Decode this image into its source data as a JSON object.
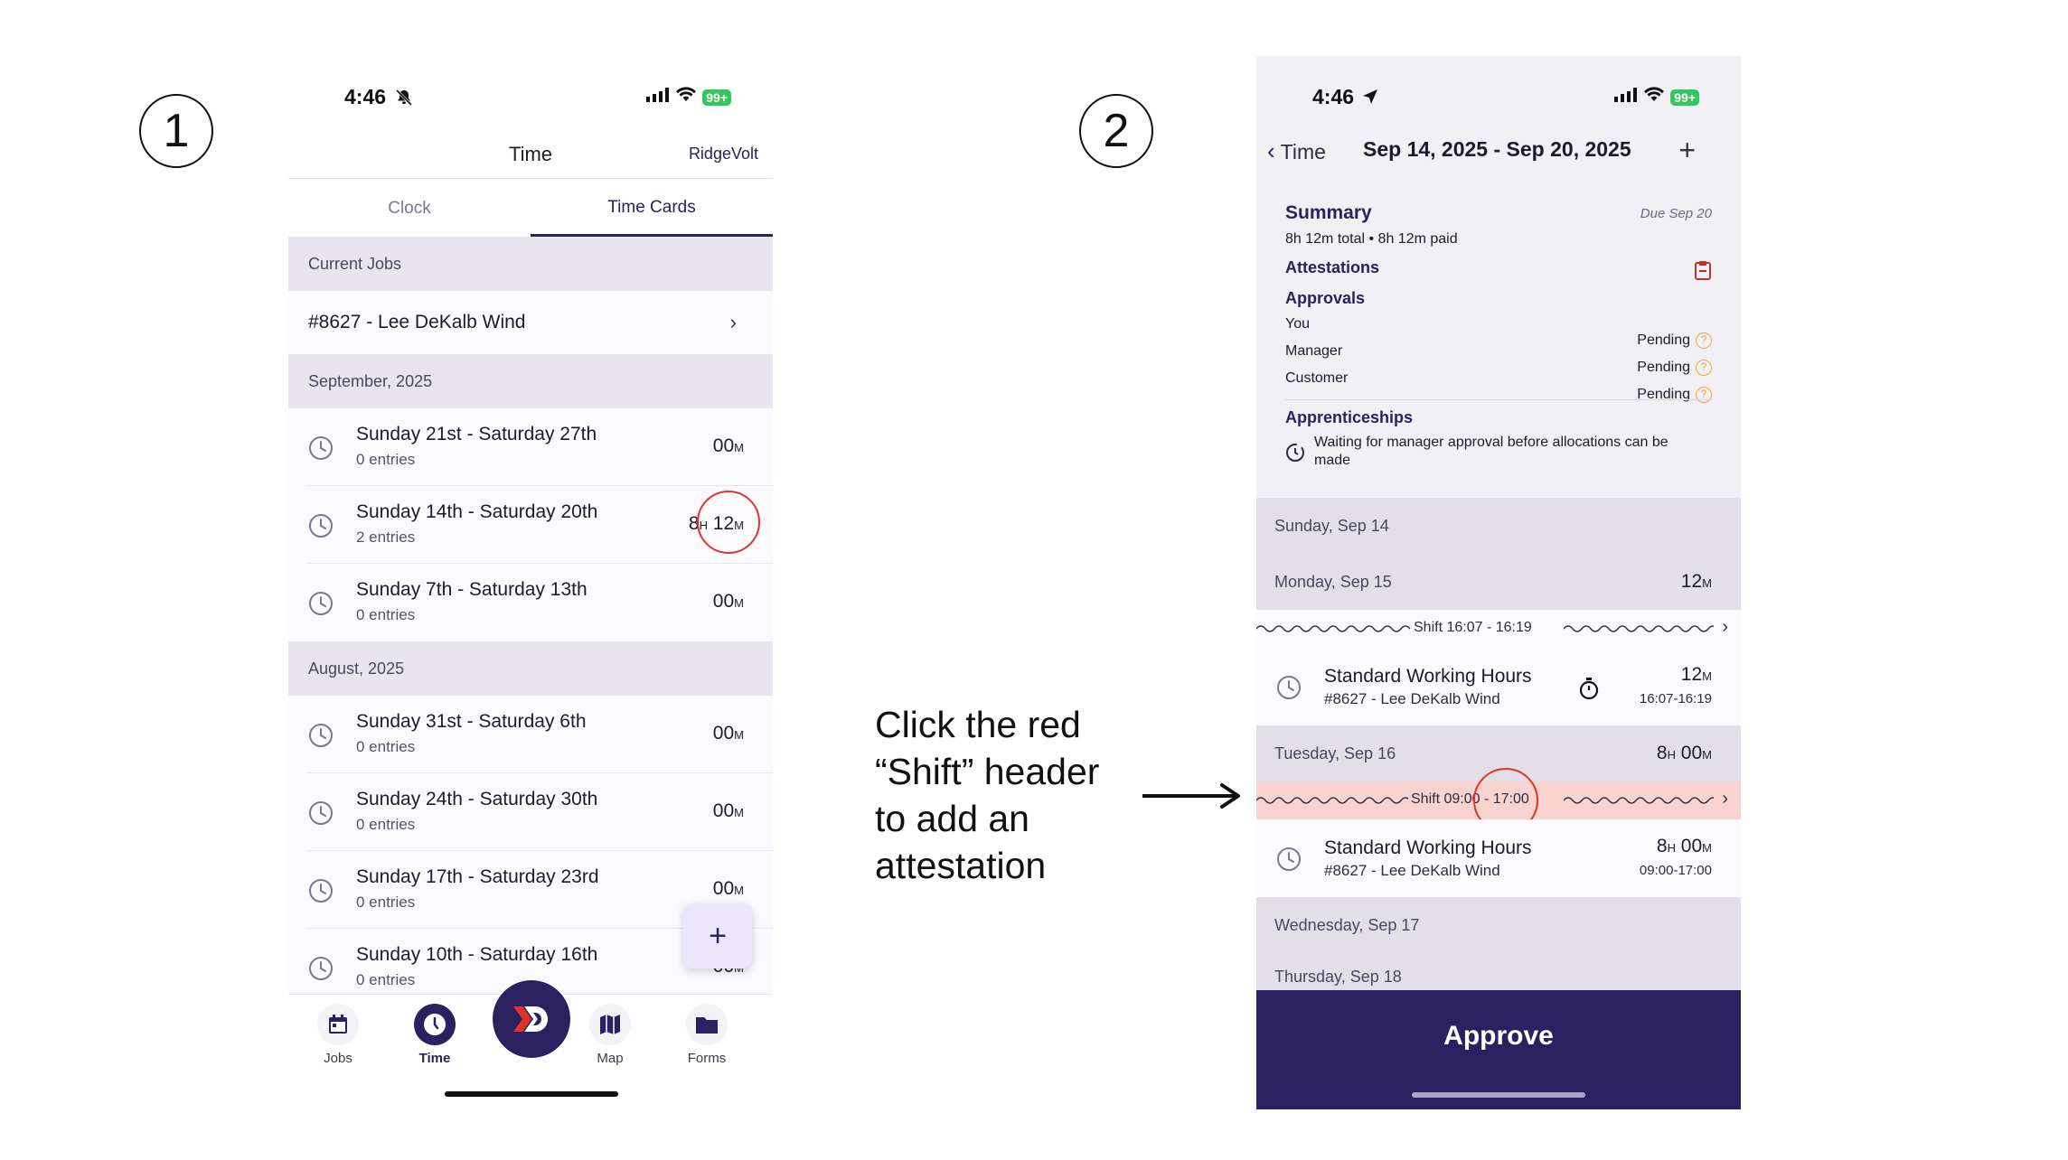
{
  "steps": {
    "one": "1",
    "two": "2"
  },
  "instruction": "Click the red “Shift” header to add an attestation",
  "phone1": {
    "status_time": "4:46",
    "battery": "99+",
    "title": "Time",
    "org": "RidgeVolt",
    "tabs": [
      {
        "label": "Clock"
      },
      {
        "label": "Time Cards"
      }
    ],
    "current_jobs_header": "Current Jobs",
    "current_job": "#8627 - Lee DeKalb Wind",
    "months": [
      {
        "label": "September, 2025",
        "weeks": [
          {
            "range": "Sunday 21st - Saturday 27th",
            "entries": "0 entries",
            "hours": "",
            "minutes": "00"
          },
          {
            "range": "Sunday 14th - Saturday 20th",
            "entries": "2 entries",
            "hours": "8",
            "minutes": "12"
          },
          {
            "range": "Sunday 7th - Saturday 13th",
            "entries": "0 entries",
            "hours": "",
            "minutes": "00"
          }
        ]
      },
      {
        "label": "August, 2025",
        "weeks": [
          {
            "range": "Sunday 31st - Saturday 6th",
            "entries": "0 entries",
            "hours": "",
            "minutes": "00"
          },
          {
            "range": "Sunday 24th - Saturday 30th",
            "entries": "0 entries",
            "hours": "",
            "minutes": "00"
          },
          {
            "range": "Sunday 17th - Saturday 23rd",
            "entries": "0 entries",
            "hours": "",
            "minutes": "00"
          },
          {
            "range": "Sunday 10th - Saturday 16th",
            "entries": "0 entries",
            "hours": "",
            "minutes": "00"
          }
        ]
      }
    ],
    "unit_h": "H",
    "unit_m": "M",
    "fab": "+",
    "tabbar": [
      {
        "label": "Jobs",
        "icon": "calendar-icon"
      },
      {
        "label": "Time",
        "icon": "clock-icon"
      },
      {
        "label": "",
        "icon": "brand-logo-icon"
      },
      {
        "label": "Map",
        "icon": "map-icon"
      },
      {
        "label": "Forms",
        "icon": "folder-icon"
      }
    ]
  },
  "phone2": {
    "status_time": "4:46",
    "battery": "99+",
    "back_label": "Time",
    "date_range": "Sep 14, 2025 - Sep 20, 2025",
    "add": "+",
    "summary": {
      "title": "Summary",
      "due": "Due Sep 20",
      "total": "8h 12m total • 8h 12m paid",
      "attestations": "Attestations",
      "approvals": "Approvals",
      "approvers": [
        {
          "who": "You",
          "status": "Pending"
        },
        {
          "who": "Manager",
          "status": "Pending"
        },
        {
          "who": "Customer",
          "status": "Pending"
        }
      ],
      "apprenticeships": "Apprenticeships",
      "apprenticeship_msg": "Waiting for manager approval before allocations can be made"
    },
    "days": {
      "sun": "Sunday, Sep 14",
      "mon": "Monday, Sep 15",
      "mon_min": "12",
      "tue": "Tuesday, Sep 16",
      "tue_h": "8",
      "tue_min": "00",
      "wed": "Wednesday, Sep 17",
      "thu": "Thursday, Sep 18"
    },
    "shifts": [
      {
        "label": "Shift 16:07 - 16:19",
        "highlight": false
      },
      {
        "label": "Shift 09:00 - 17:00",
        "highlight": true
      }
    ],
    "entries": [
      {
        "title": "Standard Working Hours",
        "job": "#8627 - Lee DeKalb Wind",
        "hours": "",
        "minutes": "12",
        "range": "16:07-16:19"
      },
      {
        "title": "Standard Working Hours",
        "job": "#8627 - Lee DeKalb Wind",
        "hours": "8",
        "minutes": "00",
        "range": "09:00-17:00"
      }
    ],
    "approve": "Approve"
  },
  "colors": {
    "brand": "#2b2160",
    "accent_red": "#e0342b",
    "shift_highlight": "#f9d3d0",
    "pending": "#f2a33a"
  }
}
